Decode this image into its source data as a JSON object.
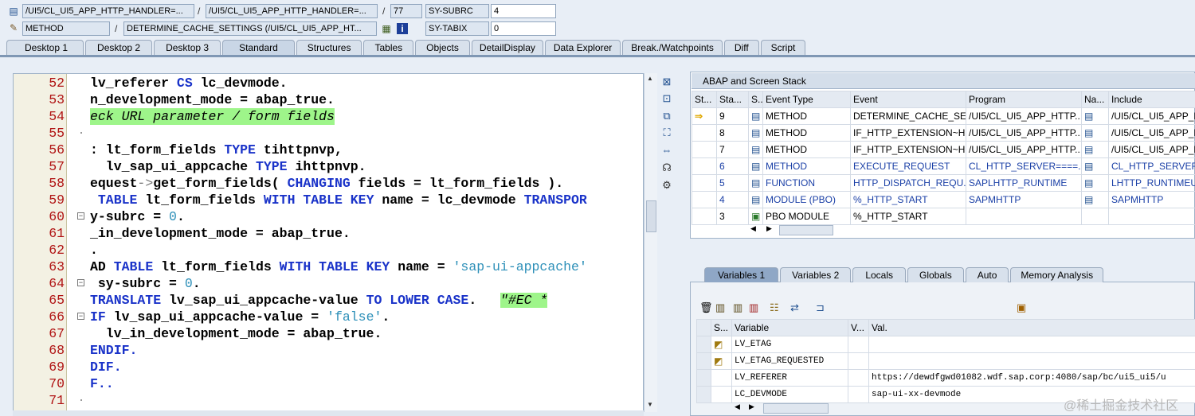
{
  "header": {
    "row1": {
      "prog1": "/UI5/CL_UI5_APP_HTTP_HANDLER=...",
      "prog2": "/UI5/CL_UI5_APP_HTTP_HANDLER=...",
      "line": "77",
      "var_name": "SY-SUBRC",
      "var_value": "4"
    },
    "row2": {
      "type": "METHOD",
      "name": "DETERMINE_CACHE_SETTINGS (/UI5/CL_UI5_APP_HT...",
      "var_name": "SY-TABIX",
      "var_value": "0"
    },
    "sep": "/"
  },
  "tabs": [
    "Desktop 1",
    "Desktop 2",
    "Desktop 3",
    "Standard",
    "Structures",
    "Tables",
    "Objects",
    "DetailDisplay",
    "Data Explorer",
    "Break./Watchpoints",
    "Diff",
    "Script"
  ],
  "code": [
    {
      "n": "52",
      "t": "lv_referer CS lc_devmode."
    },
    {
      "n": "53",
      "t": "n_development_mode = abap_true."
    },
    {
      "n": "54",
      "t": "eck URL parameter / form fields"
    },
    {
      "n": "55",
      "t": ""
    },
    {
      "n": "56",
      "t": ": lt_form_fields TYPE tihttpnvp,"
    },
    {
      "n": "57",
      "t": "  lv_sap_ui_appcache TYPE ihttpnvp."
    },
    {
      "n": "58",
      "t": "equest->get_form_fields( CHANGING fields = lt_form_fields )."
    },
    {
      "n": "59",
      "t": " TABLE lt_form_fields WITH TABLE KEY name = lc_devmode TRANSPOR"
    },
    {
      "n": "60",
      "t": "y-subrc = 0."
    },
    {
      "n": "61",
      "t": "_in_development_mode = abap_true."
    },
    {
      "n": "62",
      "t": "."
    },
    {
      "n": "63",
      "t": "AD TABLE lt_form_fields WITH TABLE KEY name = 'sap-ui-appcache'"
    },
    {
      "n": "64",
      "t": " sy-subrc = 0."
    },
    {
      "n": "65",
      "t": "TRANSLATE lv_sap_ui_appcache-value TO LOWER CASE.   \"#EC *"
    },
    {
      "n": "66",
      "t": "IF lv_sap_ui_appcache-value = 'false'."
    },
    {
      "n": "67",
      "t": "  lv_in_development_mode = abap_true."
    },
    {
      "n": "68",
      "t": "ENDIF."
    },
    {
      "n": "69",
      "t": "DIF."
    },
    {
      "n": "70",
      "t": "F.."
    },
    {
      "n": "71",
      "t": ""
    }
  ],
  "stack": {
    "title": "ABAP and Screen Stack",
    "columns": [
      "St...",
      "Sta...",
      "S...",
      "Event Type",
      "Event",
      "Program",
      "Na...",
      "Include"
    ],
    "rows": [
      {
        "level": "9",
        "etype": "METHOD",
        "event": "DETERMINE_CACHE_SET...",
        "program": "/UI5/CL_UI5_APP_HTTP...",
        "include": "/UI5/CL_UI5_APP_H"
      },
      {
        "level": "8",
        "etype": "METHOD",
        "event": "IF_HTTP_EXTENSION~H...",
        "program": "/UI5/CL_UI5_APP_HTTP...",
        "include": "/UI5/CL_UI5_APP_H"
      },
      {
        "level": "7",
        "etype": "METHOD",
        "event": "IF_HTTP_EXTENSION~H...",
        "program": "/UI5/CL_UI5_APP_HTTP...",
        "include": "/UI5/CL_UI5_APP_H"
      },
      {
        "level": "6",
        "etype": "METHOD",
        "event": "EXECUTE_REQUEST",
        "program": "CL_HTTP_SERVER====...",
        "include": "CL_HTTP_SERVER="
      },
      {
        "level": "5",
        "etype": "FUNCTION",
        "event": "HTTP_DISPATCH_REQU...",
        "program": "SAPLHTTP_RUNTIME",
        "include": "LHTTP_RUNTIMEU("
      },
      {
        "level": "4",
        "etype": "MODULE (PBO)",
        "event": "%_HTTP_START",
        "program": "SAPMHTTP",
        "include": "SAPMHTTP"
      },
      {
        "level": "3",
        "etype": "PBO MODULE",
        "event": "%_HTTP_START",
        "program": "",
        "include": ""
      }
    ]
  },
  "var_tabs": [
    "Variables 1",
    "Variables 2",
    "Locals",
    "Globals",
    "Auto",
    "Memory Analysis"
  ],
  "vars": {
    "columns": [
      "S...",
      "Variable",
      "V...",
      "Val."
    ],
    "rows": [
      {
        "name": "LV_ETAG",
        "value": ""
      },
      {
        "name": "LV_ETAG_REQUESTED",
        "value": ""
      },
      {
        "name": "LV_REFERER",
        "value": "https://dewdfgwd01082.wdf.sap.corp:4080/sap/bc/ui5_ui5/u"
      },
      {
        "name": "LC_DEVMODE",
        "value": "sap-ui-xx-devmode"
      }
    ]
  },
  "watermark": "@稀土掘金技术社区"
}
